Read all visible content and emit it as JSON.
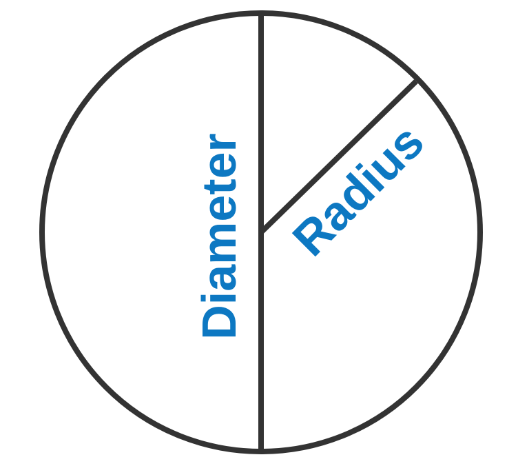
{
  "labels": {
    "diameter": "Diameter",
    "radius": "Radius"
  },
  "colors": {
    "outline": "#333333",
    "label": "#0d78c2",
    "background": "#ffffff"
  }
}
